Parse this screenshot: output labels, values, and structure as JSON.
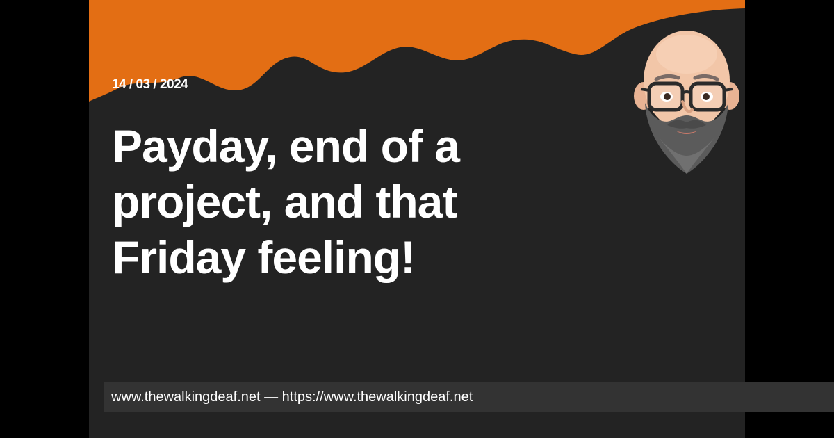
{
  "post": {
    "date": "14 / 03 / 2024",
    "title": "Payday, end of a project, and that Friday feeling!"
  },
  "footer": {
    "text": "www.thewalkingdeaf.net — https://www.thewalkingdeaf.net"
  },
  "theme": {
    "accent": "#e36e14",
    "card_bg": "#232323",
    "page_bg": "#000000",
    "footer_bg": "#333333",
    "text": "#ffffff"
  },
  "avatar": {
    "icon": "memoji-avatar-icon"
  }
}
